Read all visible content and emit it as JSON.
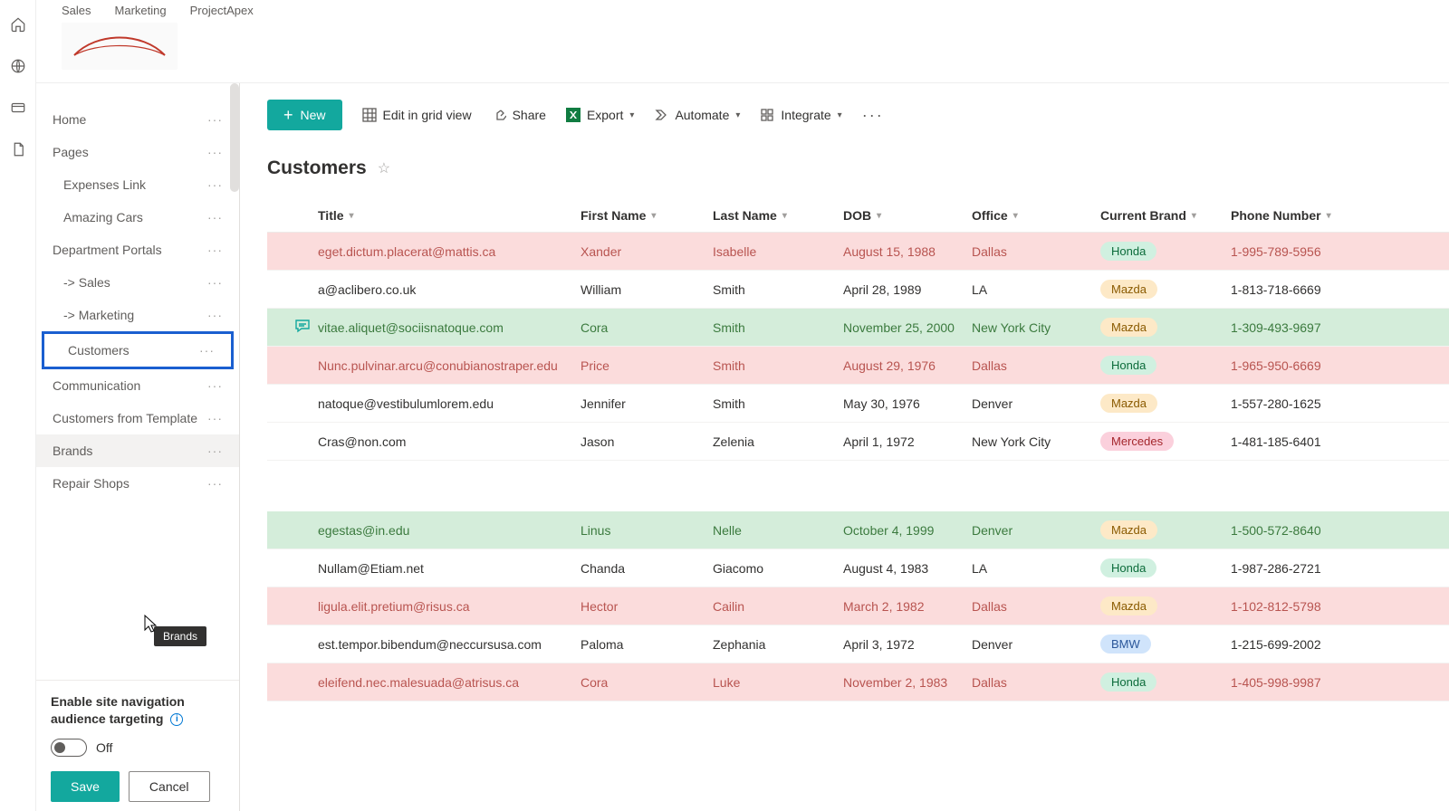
{
  "tabs": [
    "Sales",
    "Marketing",
    "ProjectApex"
  ],
  "railIcons": [
    "home-icon",
    "globe-icon",
    "card-icon",
    "document-icon"
  ],
  "nav": {
    "items": [
      {
        "label": "Home",
        "sub": false
      },
      {
        "label": "Pages",
        "sub": false
      },
      {
        "label": "Expenses Link",
        "sub": true
      },
      {
        "label": "Amazing Cars",
        "sub": true
      },
      {
        "label": "Department Portals",
        "sub": false
      },
      {
        "label": "-> Sales",
        "sub": true
      },
      {
        "label": "-> Marketing",
        "sub": true
      },
      {
        "label": "Customers",
        "sub": true,
        "selected": true
      },
      {
        "label": "Communication",
        "sub": false
      },
      {
        "label": "Customers from Template",
        "sub": false
      },
      {
        "label": "Brands",
        "sub": false,
        "hovered": true
      },
      {
        "label": "Repair Shops",
        "sub": false
      }
    ],
    "tooltip": "Brands"
  },
  "sidebarFooter": {
    "title": "Enable site navigation audience targeting",
    "toggleLabel": "Off",
    "save": "Save",
    "cancel": "Cancel"
  },
  "commandBar": {
    "new": "New",
    "editGrid": "Edit in grid view",
    "share": "Share",
    "export": "Export",
    "automate": "Automate",
    "integrate": "Integrate"
  },
  "pageTitle": "Customers",
  "columns": [
    "Title",
    "First Name",
    "Last Name",
    "DOB",
    "Office",
    "Current Brand",
    "Phone Number"
  ],
  "rows": [
    {
      "color": "red",
      "title": "eget.dictum.placerat@mattis.ca",
      "first": "Xander",
      "last": "Isabelle",
      "dob": "August 15, 1988",
      "office": "Dallas",
      "brand": "Honda",
      "phone": "1-995-789-5956"
    },
    {
      "color": "",
      "title": "a@aclibero.co.uk",
      "first": "William",
      "last": "Smith",
      "dob": "April 28, 1989",
      "office": "LA",
      "brand": "Mazda",
      "phone": "1-813-718-6669"
    },
    {
      "color": "green",
      "title": "vitae.aliquet@sociisnatoque.com",
      "first": "Cora",
      "last": "Smith",
      "dob": "November 25, 2000",
      "office": "New York City",
      "brand": "Mazda",
      "phone": "1-309-493-9697",
      "comment": true
    },
    {
      "color": "red",
      "title": "Nunc.pulvinar.arcu@conubianostraper.edu",
      "first": "Price",
      "last": "Smith",
      "dob": "August 29, 1976",
      "office": "Dallas",
      "brand": "Honda",
      "phone": "1-965-950-6669"
    },
    {
      "color": "",
      "title": "natoque@vestibulumlorem.edu",
      "first": "Jennifer",
      "last": "Smith",
      "dob": "May 30, 1976",
      "office": "Denver",
      "brand": "Mazda",
      "phone": "1-557-280-1625"
    },
    {
      "color": "",
      "title": "Cras@non.com",
      "first": "Jason",
      "last": "Zelenia",
      "dob": "April 1, 1972",
      "office": "New York City",
      "brand": "Mercedes",
      "phone": "1-481-185-6401"
    }
  ],
  "rows2": [
    {
      "color": "green",
      "title": "egestas@in.edu",
      "first": "Linus",
      "last": "Nelle",
      "dob": "October 4, 1999",
      "office": "Denver",
      "brand": "Mazda",
      "phone": "1-500-572-8640"
    },
    {
      "color": "",
      "title": "Nullam@Etiam.net",
      "first": "Chanda",
      "last": "Giacomo",
      "dob": "August 4, 1983",
      "office": "LA",
      "brand": "Honda",
      "phone": "1-987-286-2721"
    },
    {
      "color": "red",
      "title": "ligula.elit.pretium@risus.ca",
      "first": "Hector",
      "last": "Cailin",
      "dob": "March 2, 1982",
      "office": "Dallas",
      "brand": "Mazda",
      "phone": "1-102-812-5798"
    },
    {
      "color": "",
      "title": "est.tempor.bibendum@neccursusa.com",
      "first": "Paloma",
      "last": "Zephania",
      "dob": "April 3, 1972",
      "office": "Denver",
      "brand": "BMW",
      "phone": "1-215-699-2002"
    },
    {
      "color": "red",
      "title": "eleifend.nec.malesuada@atrisus.ca",
      "first": "Cora",
      "last": "Luke",
      "dob": "November 2, 1983",
      "office": "Dallas",
      "brand": "Honda",
      "phone": "1-405-998-9987"
    }
  ]
}
